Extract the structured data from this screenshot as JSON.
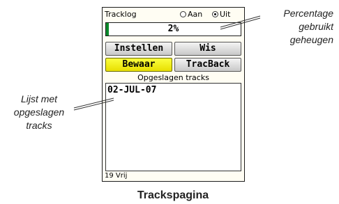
{
  "screen": {
    "title": "Tracklog",
    "radio_on_label": "Aan",
    "radio_off_label": "Uit",
    "selected": "Uit",
    "progress_percent": 2,
    "progress_text": "2%",
    "buttons": {
      "setup": "Instellen",
      "clear": "Wis",
      "save": "Bewaar",
      "tracback": "TracBack"
    },
    "saved_tracks_header": "Opgeslagen tracks",
    "tracks": [
      "02-JUL-07"
    ],
    "status": "19 Vrij"
  },
  "annotations": {
    "right_line1": "Percentage",
    "right_line2": "gebruikt",
    "right_line3": "geheugen",
    "left_line1": "Lijst met",
    "left_line2": "opgeslagen",
    "left_line3": "tracks"
  },
  "caption": "Trackspagina",
  "colors": {
    "progress_fill": "#0a8a2a",
    "selected_button": "#f5f000"
  }
}
